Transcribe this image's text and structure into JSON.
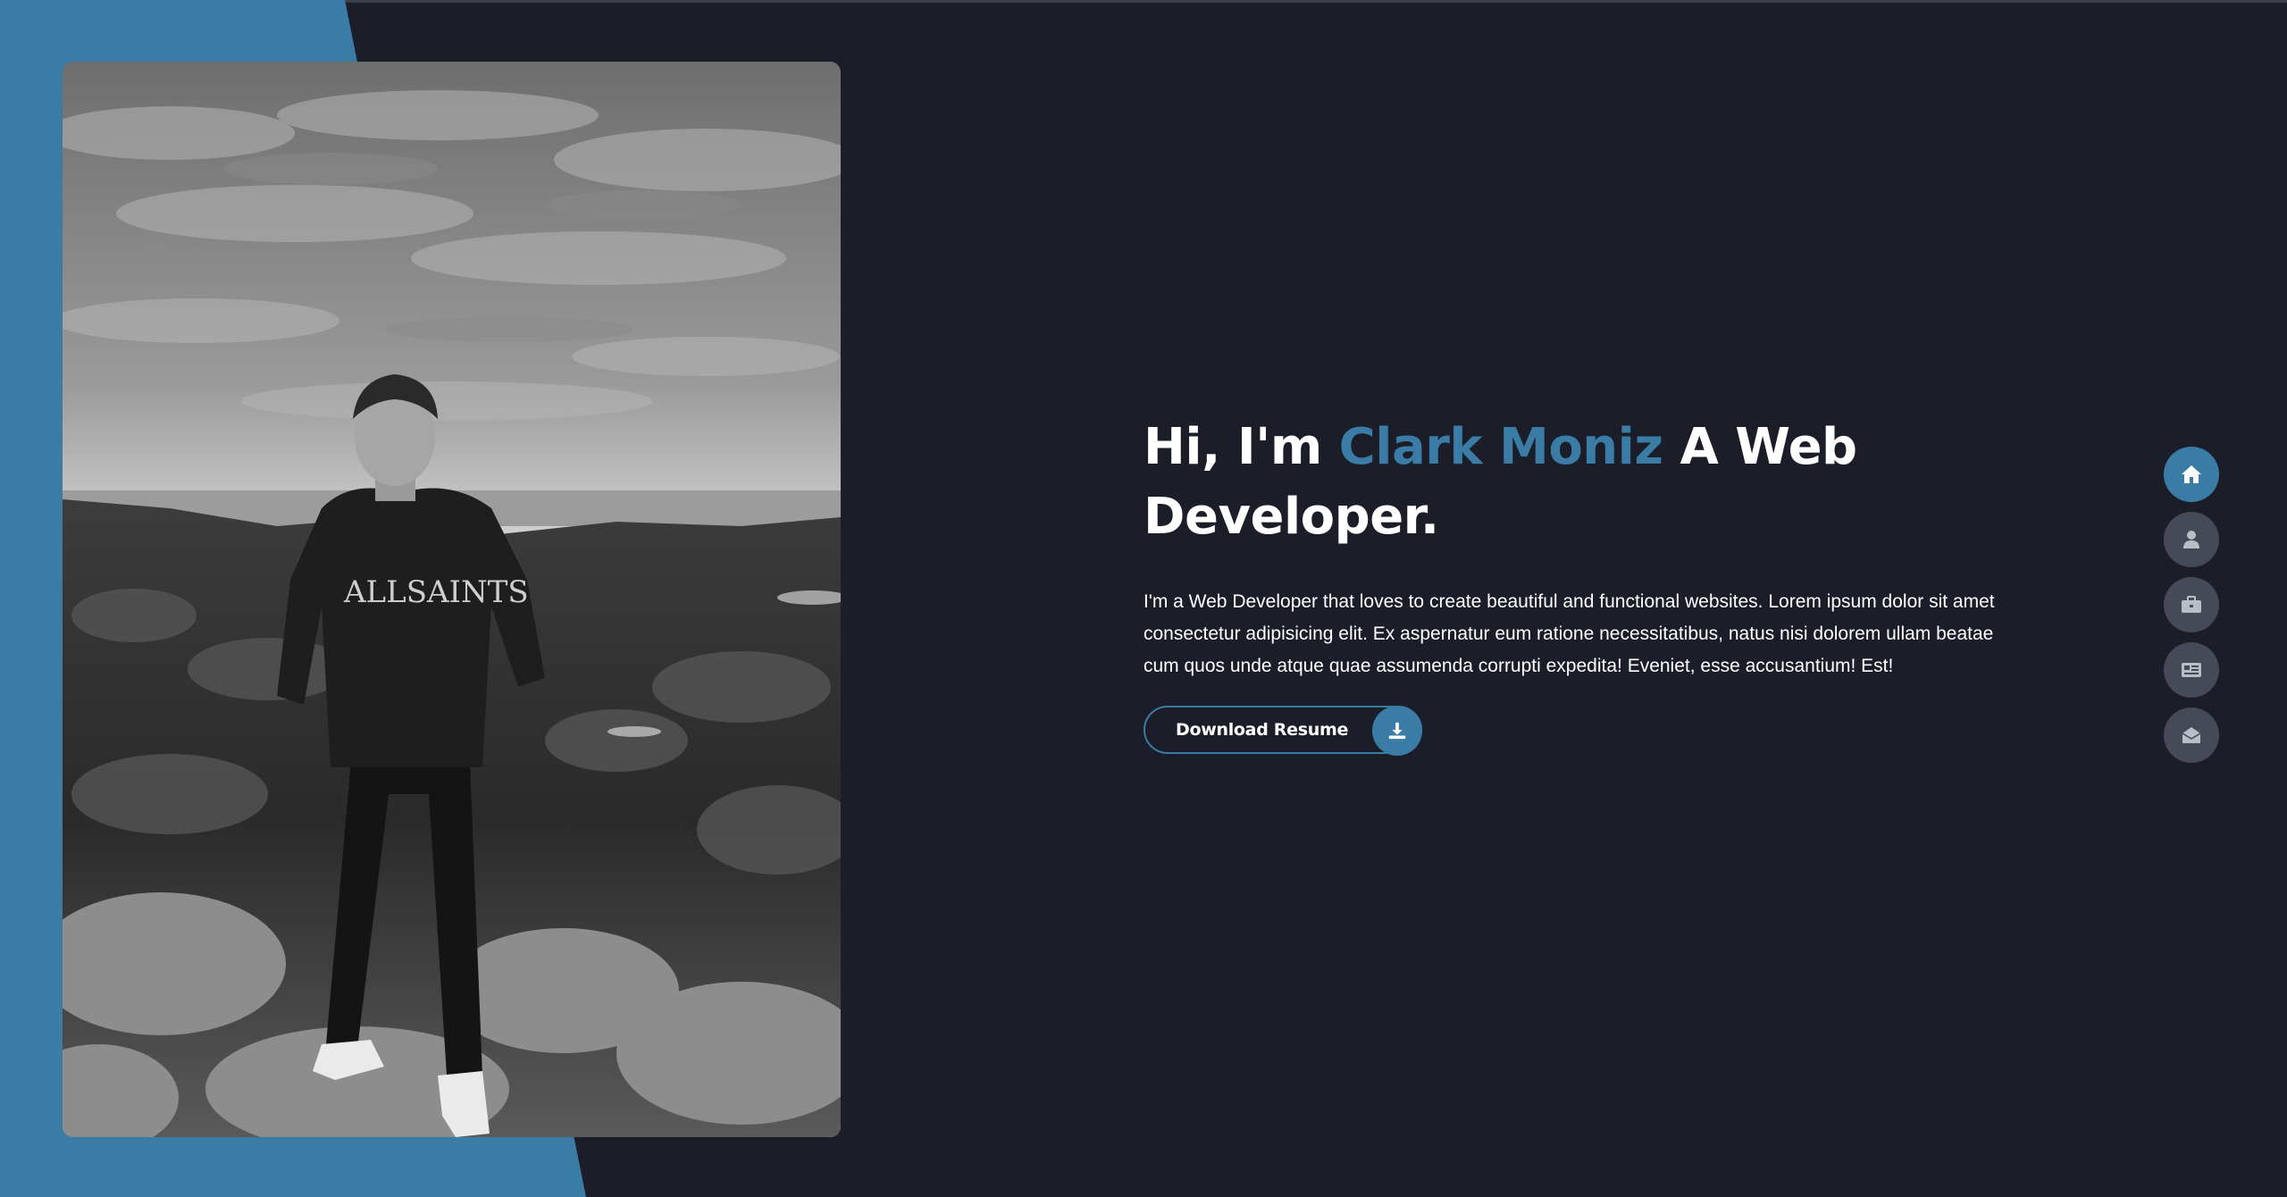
{
  "hero": {
    "greeting": "Hi, I'm ",
    "name": "Clark Moniz",
    "role": " A Web Developer.",
    "description": "I'm a Web Developer that loves to create beautiful and functional websites. Lorem ipsum dolor sit amet consectetur adipisicing elit. Ex aspernatur eum ratione necessitatibus, natus nisi dolorem ullam beatae cum quos unde atque quae assumenda corrupti expedita! Eveniet, esse accusantium! Est!",
    "button_label": "Download Resume",
    "button_icon": "download-icon"
  },
  "photo": {
    "shirt_text": "ALLSAINTS"
  },
  "nav": {
    "items": [
      {
        "icon": "home-icon",
        "active": true
      },
      {
        "icon": "user-icon",
        "active": false
      },
      {
        "icon": "briefcase-icon",
        "active": false
      },
      {
        "icon": "newspaper-icon",
        "active": false
      },
      {
        "icon": "envelope-open-icon",
        "active": false
      }
    ]
  },
  "colors": {
    "background": "#1b1d28",
    "accent": "#3a7ca5",
    "nav_inactive": "#454a56",
    "text": "#ffffff"
  }
}
